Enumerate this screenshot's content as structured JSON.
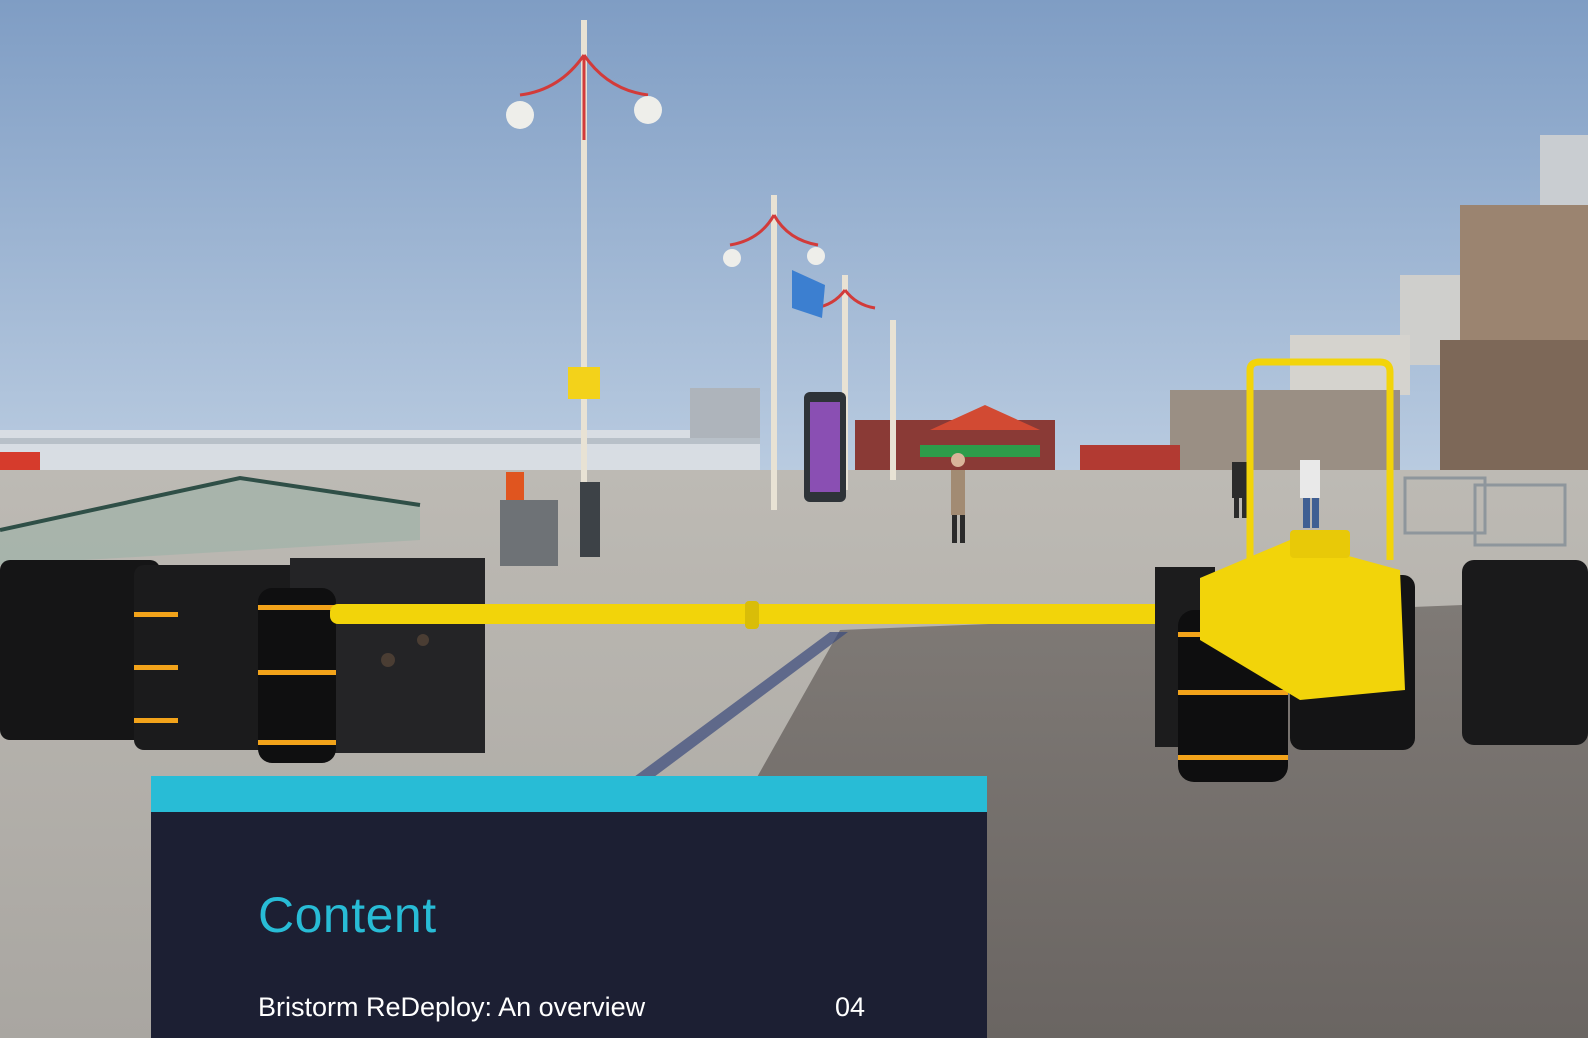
{
  "toc": {
    "title": "Content",
    "items": [
      {
        "label": "Bristorm ReDeploy: An overview",
        "page": "04"
      }
    ]
  },
  "colors": {
    "accent": "#28bcd6",
    "panel": "#1c1f33",
    "text": "#ffffff",
    "barrier_yellow": "#f2d40a"
  }
}
